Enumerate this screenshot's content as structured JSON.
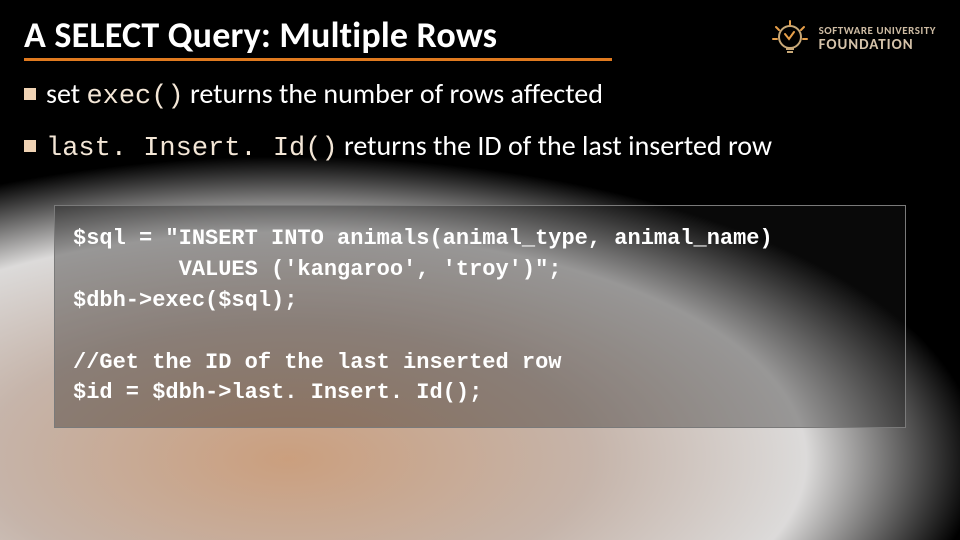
{
  "title": "A SELECT Query:  Multiple Rows",
  "logo": {
    "line1": "SOFTWARE UNIVERSITY",
    "line2": "FOUNDATION"
  },
  "bullets": [
    {
      "prefix": "set ",
      "code": "exec()",
      "suffix": "  returns the number of rows affected"
    },
    {
      "prefix": "",
      "code": "last. Insert. Id()",
      "suffix": "  returns the ID of the last inserted row"
    }
  ],
  "code": "$sql = \"INSERT INTO animals(animal_type, animal_name)\n        VALUES ('kangaroo', 'troy')\";\n$dbh->exec($sql);\n\n//Get the ID of the last inserted row\n$id = $dbh->last. Insert. Id();"
}
